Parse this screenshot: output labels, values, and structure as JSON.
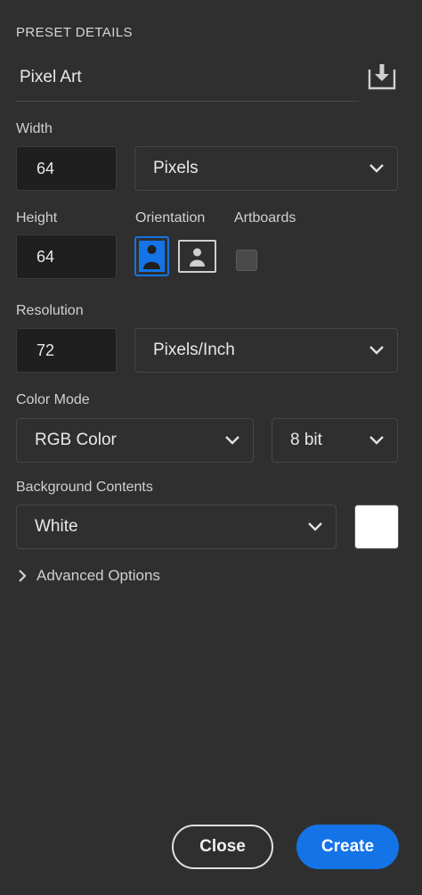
{
  "header": {
    "title": "PRESET DETAILS"
  },
  "preset": {
    "name": "Pixel Art",
    "save_icon": "save-preset-icon"
  },
  "width": {
    "label": "Width",
    "value": "64",
    "unit": "Pixels"
  },
  "height": {
    "label": "Height",
    "value": "64"
  },
  "orientation": {
    "label": "Orientation",
    "selected": "portrait"
  },
  "artboards": {
    "label": "Artboards",
    "checked": false
  },
  "resolution": {
    "label": "Resolution",
    "value": "72",
    "unit": "Pixels/Inch"
  },
  "color_mode": {
    "label": "Color Mode",
    "mode": "RGB Color",
    "depth": "8 bit"
  },
  "background": {
    "label": "Background Contents",
    "value": "White",
    "swatch_color": "#ffffff"
  },
  "advanced": {
    "label": "Advanced Options"
  },
  "buttons": {
    "close": "Close",
    "create": "Create"
  },
  "colors": {
    "accent": "#1473e6",
    "panel": "#2f2f2f",
    "field": "#1f1f1f"
  }
}
